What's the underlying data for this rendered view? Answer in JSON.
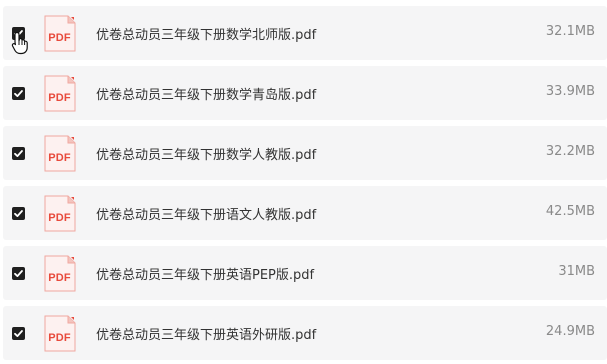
{
  "files": [
    {
      "name": "优卷总动员三年级下册数学北师版.pdf",
      "size": "32.1MB",
      "checked": true,
      "icon_label": "PDF"
    },
    {
      "name": "优卷总动员三年级下册数学青岛版.pdf",
      "size": "33.9MB",
      "checked": true,
      "icon_label": "PDF"
    },
    {
      "name": "优卷总动员三年级下册数学人教版.pdf",
      "size": "32.2MB",
      "checked": true,
      "icon_label": "PDF"
    },
    {
      "name": "优卷总动员三年级下册语文人教版.pdf",
      "size": "42.5MB",
      "checked": true,
      "icon_label": "PDF"
    },
    {
      "name": "优卷总动员三年级下册英语PEP版.pdf",
      "size": "31MB",
      "checked": true,
      "icon_label": "PDF"
    },
    {
      "name": "优卷总动员三年级下册英语外研版.pdf",
      "size": "24.9MB",
      "checked": true,
      "icon_label": "PDF"
    }
  ],
  "icons": {
    "file": "pdf-file-icon",
    "checkbox": "checkmark-icon",
    "cursor": "hand-pointer-icon"
  },
  "colors": {
    "row_background": "#f5f5f6",
    "checkbox": "#1f1f1f",
    "pdf_red": "#e84a3c",
    "name_text": "#333333",
    "size_text": "#8a8a8a"
  }
}
